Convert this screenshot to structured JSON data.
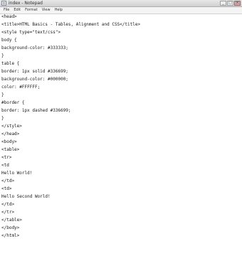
{
  "window": {
    "title": "index - Notepad",
    "controls": [
      "_",
      "□",
      "×"
    ]
  },
  "menu": {
    "items": [
      "File",
      "Edit",
      "Format",
      "View",
      "Help"
    ]
  },
  "editor": {
    "lines": [
      "<head>",
      "<title>HTML Basics - Tables, Alignment and CSS</title>",
      "<style type=\"text/css\">",
      "body {",
      "background-color: #333333;",
      "}",
      "table {",
      "border: 1px solid #336699;",
      "background-color: #000000;",
      "color: #FFFFFF;",
      "}",
      "#border {",
      "border: 1px dashed #336699;",
      "}",
      "</style>",
      "</head>",
      "<body>",
      "<table>",
      "<tr>",
      "<td ",
      "Hello World!",
      "</td>",
      "<td>",
      "Hello Second World!",
      "</td>",
      "</tr>",
      "</table>",
      "</body>",
      "</html>"
    ]
  }
}
